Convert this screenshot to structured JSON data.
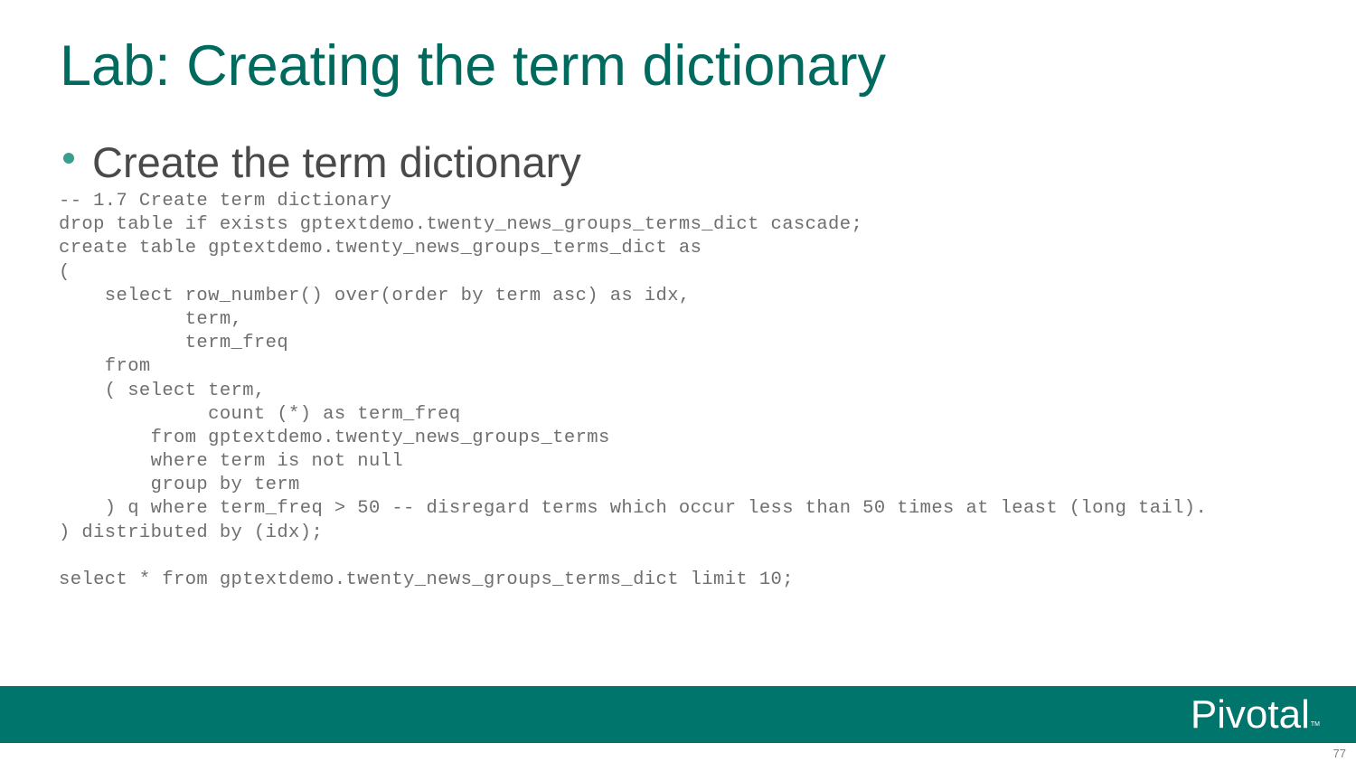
{
  "slide": {
    "title": "Lab: Creating the term dictionary",
    "bullet": "Create the term dictionary",
    "page_number": "77"
  },
  "code_lines": [
    "-- 1.7 Create term dictionary",
    "drop table if exists gptextdemo.twenty_news_groups_terms_dict cascade;",
    "create table gptextdemo.twenty_news_groups_terms_dict as",
    "(",
    "    select row_number() over(order by term asc) as idx,",
    "           term,",
    "           term_freq",
    "    from",
    "    ( select term,",
    "             count (*) as term_freq",
    "        from gptextdemo.twenty_news_groups_terms",
    "        where term is not null",
    "        group by term",
    "    ) q where term_freq > 50 -- disregard terms which occur less than 50 times at least (long tail).",
    ") distributed by (idx);",
    "",
    "select * from gptextdemo.twenty_news_groups_terms_dict limit 10;"
  ],
  "brand": {
    "name": "Pivotal",
    "trademark": "TM"
  },
  "colors": {
    "title": "#006a5e",
    "bullet_dot": "#3a9d8f",
    "bullet_text": "#4a4a4a",
    "code_text": "#6f6f6f",
    "footer_band": "#00756b",
    "page_number": "#7f7f7f"
  }
}
